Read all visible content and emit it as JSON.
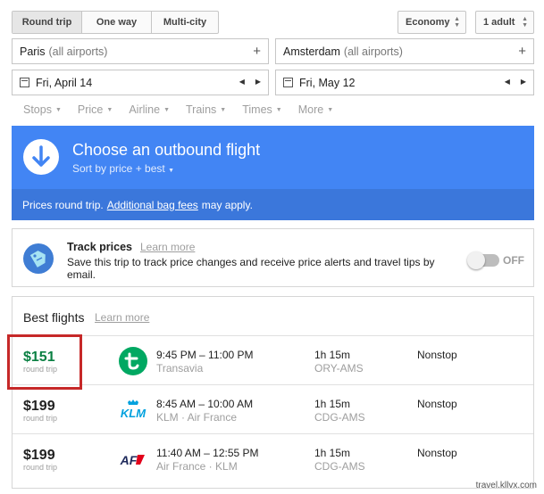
{
  "trip_type": {
    "options": [
      "Round trip",
      "One way",
      "Multi-city"
    ],
    "selected": "Round trip"
  },
  "cabin_class": "Economy",
  "passengers": "1 adult",
  "origin": {
    "city": "Paris",
    "qualifier": "(all airports)"
  },
  "destination": {
    "city": "Amsterdam",
    "qualifier": "(all airports)"
  },
  "depart_date": "Fri, April 14",
  "return_date": "Fri, May 12",
  "filters": [
    "Stops",
    "Price",
    "Airline",
    "Trains",
    "Times",
    "More"
  ],
  "banner": {
    "title": "Choose an outbound flight",
    "sort": "Sort by price + best",
    "note_prefix": "Prices round trip.",
    "note_link": "Additional bag fees",
    "note_suffix": "may apply."
  },
  "track_prices": {
    "title": "Track prices",
    "learn_more": "Learn more",
    "description": "Save this trip to track price changes and receive price alerts and travel tips by email.",
    "toggle_label": "OFF"
  },
  "best_flights": {
    "title": "Best flights",
    "learn_more": "Learn more",
    "price_sub": "round trip",
    "flights": [
      {
        "price": "$151",
        "times": "9:45 PM – 11:00 PM",
        "airline": "Transavia",
        "duration": "1h 15m",
        "route": "ORY-AMS",
        "stops": "Nonstop",
        "logo": "transavia-logo-icon"
      },
      {
        "price": "$199",
        "times": "8:45 AM – 10:00 AM",
        "airline": "KLM · Air France",
        "duration": "1h 15m",
        "route": "CDG-AMS",
        "stops": "Nonstop",
        "logo": "klm-logo-icon",
        "logo_text": "KLM"
      },
      {
        "price": "$199",
        "times": "11:40 AM – 12:55 PM",
        "airline": "Air France · KLM",
        "duration": "1h 15m",
        "route": "CDG-AMS",
        "stops": "Nonstop",
        "logo": "air-france-logo-icon",
        "logo_text": "AF"
      }
    ]
  },
  "watermark": "travel.kllvx.com",
  "colors": {
    "banner": "#4285f4",
    "banner_subbar": "#3b77db",
    "best_price": "#0b8043",
    "highlight": "#c62828"
  }
}
